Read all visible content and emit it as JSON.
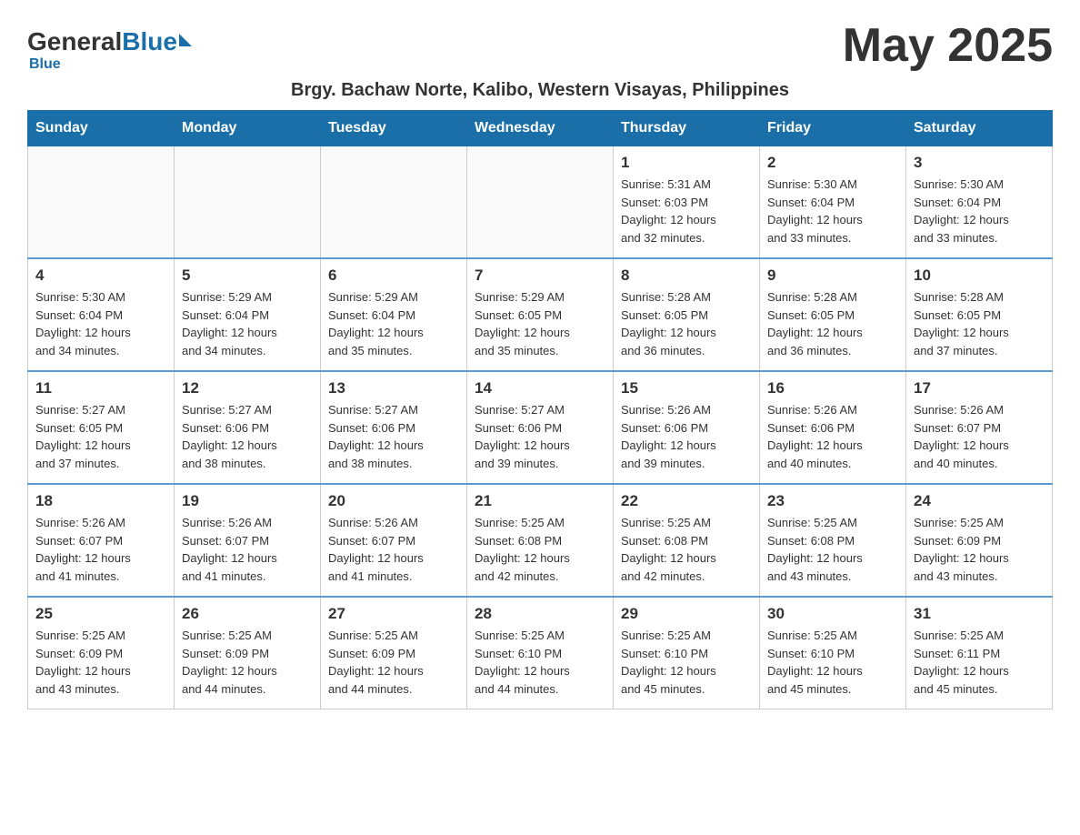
{
  "header": {
    "logo": {
      "general": "General",
      "blue": "Blue",
      "triangle": "▶"
    },
    "month_title": "May 2025"
  },
  "subtitle": "Brgy. Bachaw Norte, Kalibo, Western Visayas, Philippines",
  "calendar": {
    "days_of_week": [
      "Sunday",
      "Monday",
      "Tuesday",
      "Wednesday",
      "Thursday",
      "Friday",
      "Saturday"
    ],
    "weeks": [
      [
        {
          "day": "",
          "info": ""
        },
        {
          "day": "",
          "info": ""
        },
        {
          "day": "",
          "info": ""
        },
        {
          "day": "",
          "info": ""
        },
        {
          "day": "1",
          "info": "Sunrise: 5:31 AM\nSunset: 6:03 PM\nDaylight: 12 hours\nand 32 minutes."
        },
        {
          "day": "2",
          "info": "Sunrise: 5:30 AM\nSunset: 6:04 PM\nDaylight: 12 hours\nand 33 minutes."
        },
        {
          "day": "3",
          "info": "Sunrise: 5:30 AM\nSunset: 6:04 PM\nDaylight: 12 hours\nand 33 minutes."
        }
      ],
      [
        {
          "day": "4",
          "info": "Sunrise: 5:30 AM\nSunset: 6:04 PM\nDaylight: 12 hours\nand 34 minutes."
        },
        {
          "day": "5",
          "info": "Sunrise: 5:29 AM\nSunset: 6:04 PM\nDaylight: 12 hours\nand 34 minutes."
        },
        {
          "day": "6",
          "info": "Sunrise: 5:29 AM\nSunset: 6:04 PM\nDaylight: 12 hours\nand 35 minutes."
        },
        {
          "day": "7",
          "info": "Sunrise: 5:29 AM\nSunset: 6:05 PM\nDaylight: 12 hours\nand 35 minutes."
        },
        {
          "day": "8",
          "info": "Sunrise: 5:28 AM\nSunset: 6:05 PM\nDaylight: 12 hours\nand 36 minutes."
        },
        {
          "day": "9",
          "info": "Sunrise: 5:28 AM\nSunset: 6:05 PM\nDaylight: 12 hours\nand 36 minutes."
        },
        {
          "day": "10",
          "info": "Sunrise: 5:28 AM\nSunset: 6:05 PM\nDaylight: 12 hours\nand 37 minutes."
        }
      ],
      [
        {
          "day": "11",
          "info": "Sunrise: 5:27 AM\nSunset: 6:05 PM\nDaylight: 12 hours\nand 37 minutes."
        },
        {
          "day": "12",
          "info": "Sunrise: 5:27 AM\nSunset: 6:06 PM\nDaylight: 12 hours\nand 38 minutes."
        },
        {
          "day": "13",
          "info": "Sunrise: 5:27 AM\nSunset: 6:06 PM\nDaylight: 12 hours\nand 38 minutes."
        },
        {
          "day": "14",
          "info": "Sunrise: 5:27 AM\nSunset: 6:06 PM\nDaylight: 12 hours\nand 39 minutes."
        },
        {
          "day": "15",
          "info": "Sunrise: 5:26 AM\nSunset: 6:06 PM\nDaylight: 12 hours\nand 39 minutes."
        },
        {
          "day": "16",
          "info": "Sunrise: 5:26 AM\nSunset: 6:06 PM\nDaylight: 12 hours\nand 40 minutes."
        },
        {
          "day": "17",
          "info": "Sunrise: 5:26 AM\nSunset: 6:07 PM\nDaylight: 12 hours\nand 40 minutes."
        }
      ],
      [
        {
          "day": "18",
          "info": "Sunrise: 5:26 AM\nSunset: 6:07 PM\nDaylight: 12 hours\nand 41 minutes."
        },
        {
          "day": "19",
          "info": "Sunrise: 5:26 AM\nSunset: 6:07 PM\nDaylight: 12 hours\nand 41 minutes."
        },
        {
          "day": "20",
          "info": "Sunrise: 5:26 AM\nSunset: 6:07 PM\nDaylight: 12 hours\nand 41 minutes."
        },
        {
          "day": "21",
          "info": "Sunrise: 5:25 AM\nSunset: 6:08 PM\nDaylight: 12 hours\nand 42 minutes."
        },
        {
          "day": "22",
          "info": "Sunrise: 5:25 AM\nSunset: 6:08 PM\nDaylight: 12 hours\nand 42 minutes."
        },
        {
          "day": "23",
          "info": "Sunrise: 5:25 AM\nSunset: 6:08 PM\nDaylight: 12 hours\nand 43 minutes."
        },
        {
          "day": "24",
          "info": "Sunrise: 5:25 AM\nSunset: 6:09 PM\nDaylight: 12 hours\nand 43 minutes."
        }
      ],
      [
        {
          "day": "25",
          "info": "Sunrise: 5:25 AM\nSunset: 6:09 PM\nDaylight: 12 hours\nand 43 minutes."
        },
        {
          "day": "26",
          "info": "Sunrise: 5:25 AM\nSunset: 6:09 PM\nDaylight: 12 hours\nand 44 minutes."
        },
        {
          "day": "27",
          "info": "Sunrise: 5:25 AM\nSunset: 6:09 PM\nDaylight: 12 hours\nand 44 minutes."
        },
        {
          "day": "28",
          "info": "Sunrise: 5:25 AM\nSunset: 6:10 PM\nDaylight: 12 hours\nand 44 minutes."
        },
        {
          "day": "29",
          "info": "Sunrise: 5:25 AM\nSunset: 6:10 PM\nDaylight: 12 hours\nand 45 minutes."
        },
        {
          "day": "30",
          "info": "Sunrise: 5:25 AM\nSunset: 6:10 PM\nDaylight: 12 hours\nand 45 minutes."
        },
        {
          "day": "31",
          "info": "Sunrise: 5:25 AM\nSunset: 6:11 PM\nDaylight: 12 hours\nand 45 minutes."
        }
      ]
    ]
  }
}
